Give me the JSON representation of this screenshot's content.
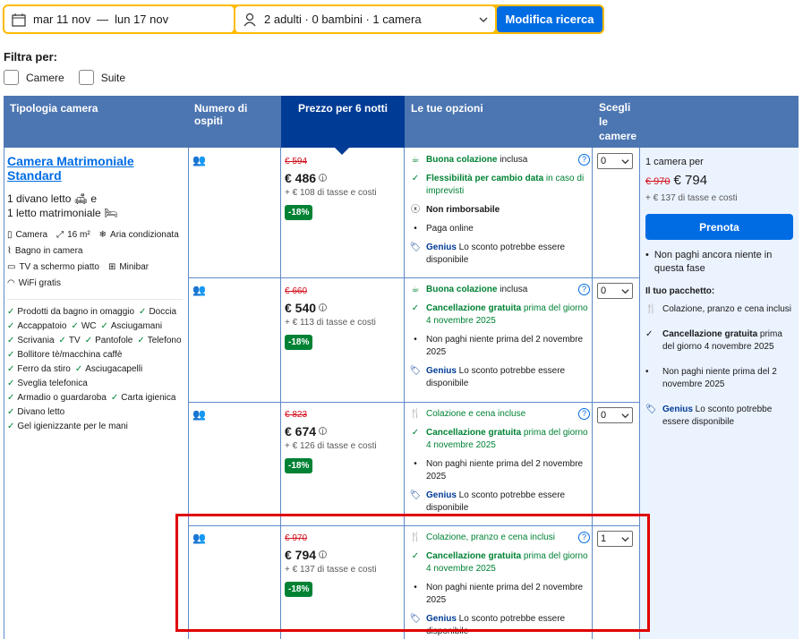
{
  "search": {
    "checkin": "mar 11 nov",
    "dash": "—",
    "checkout": "lun 17 nov",
    "guests": "2 adulti · 0 bambini · 1 camera",
    "button": "Modifica ricerca"
  },
  "filter": {
    "title": "Filtra per:",
    "options": [
      "Camere",
      "Suite"
    ]
  },
  "table_headers": {
    "type": "Tipologia camera",
    "guests": "Numero di ospiti",
    "price": "Prezzo per 6 notti",
    "options": "Le tue opzioni",
    "choose": "Scegli le camere"
  },
  "room": {
    "name": "Camera Matrimoniale Standard",
    "bed1": "1 divano letto",
    "bed_e": "e",
    "bed2": "1 letto matrimoniale",
    "features": [
      "Camera",
      "16 m²",
      "Aria condizionata",
      "Bagno in camera",
      "TV a schermo piatto",
      "Minibar",
      "WiFi gratis"
    ],
    "amenities": [
      [
        "Prodotti da bagno in omaggio",
        "Doccia"
      ],
      [
        "Accappatoio",
        "WC",
        "Asciugamani"
      ],
      [
        "Scrivania",
        "TV",
        "Pantofole",
        "Telefono"
      ],
      [
        "Bollitore tè/macchina caffè"
      ],
      [
        "Ferro da stiro",
        "Asciugacapelli"
      ],
      [
        "Sveglia telefonica"
      ],
      [
        "Armadio o guardaroba",
        "Carta igienica"
      ],
      [
        "Divano letto"
      ],
      [
        "Gel igienizzante per le mani"
      ]
    ]
  },
  "rows": [
    {
      "old": "€ 594",
      "new": "€ 486",
      "taxes": "+ € 108 di tasse e costi",
      "disc": "-18%",
      "o1a": "Buona colazione",
      "o1b": " inclusa",
      "o2a": "Flessibilità per cambio data",
      "o2b": " in caso di imprevisti",
      "o3": "Non rimborsabile",
      "o4": "Paga online",
      "g1": "Genius",
      "g2": " Lo sconto potrebbe essere disponibile",
      "qty": "0"
    },
    {
      "old": "€ 660",
      "new": "€ 540",
      "taxes": "+ € 113 di tasse e costi",
      "disc": "-18%",
      "o1a": "Buona colazione",
      "o1b": " inclusa",
      "o2a": "Cancellazione gratuita",
      "o2b": " prima del giorno 4 novembre 2025",
      "o3": "Non paghi niente prima del 2 novembre 2025",
      "g1": "Genius",
      "g2": " Lo sconto potrebbe essere disponibile",
      "qty": "0"
    },
    {
      "old": "€ 823",
      "new": "€ 674",
      "taxes": "+ € 126 di tasse e costi",
      "disc": "-18%",
      "o1": "Colazione e cena incluse",
      "o2a": "Cancellazione gratuita",
      "o2b": " prima del giorno 4 novembre 2025",
      "o3": "Non paghi niente prima del 2 novembre 2025",
      "g1": "Genius",
      "g2": " Lo sconto potrebbe essere disponibile",
      "qty": "0"
    },
    {
      "old": "€ 970",
      "new": "€ 794",
      "taxes": "+ € 137 di tasse e costi",
      "disc": "-18%",
      "o1": "Colazione, pranzo e cena inclusi",
      "o2a": "Cancellazione gratuita",
      "o2b": " prima del giorno 4 novembre 2025",
      "o3": "Non paghi niente prima del 2 novembre 2025",
      "g1": "Genius",
      "g2": " Lo sconto potrebbe essere disponibile",
      "qty": "1"
    }
  ],
  "summary": {
    "rooms": "1 camera per",
    "old": "€ 970",
    "new": "€ 794",
    "taxes": "+ € 137 di tasse e costi",
    "button": "Prenota",
    "note": "Non paghi ancora niente in questa fase",
    "pkg_title": "Il tuo pacchetto:",
    "pkg1": "Colazione, pranzo e cena inclusi",
    "pkg2a": "Cancellazione gratuita",
    "pkg2b": " prima del giorno 4 novembre 2025",
    "pkg3": "Non paghi niente prima del 2 novembre 2025",
    "pkg4a": "Genius",
    "pkg4b": " Lo sconto potrebbe essere disponibile"
  }
}
